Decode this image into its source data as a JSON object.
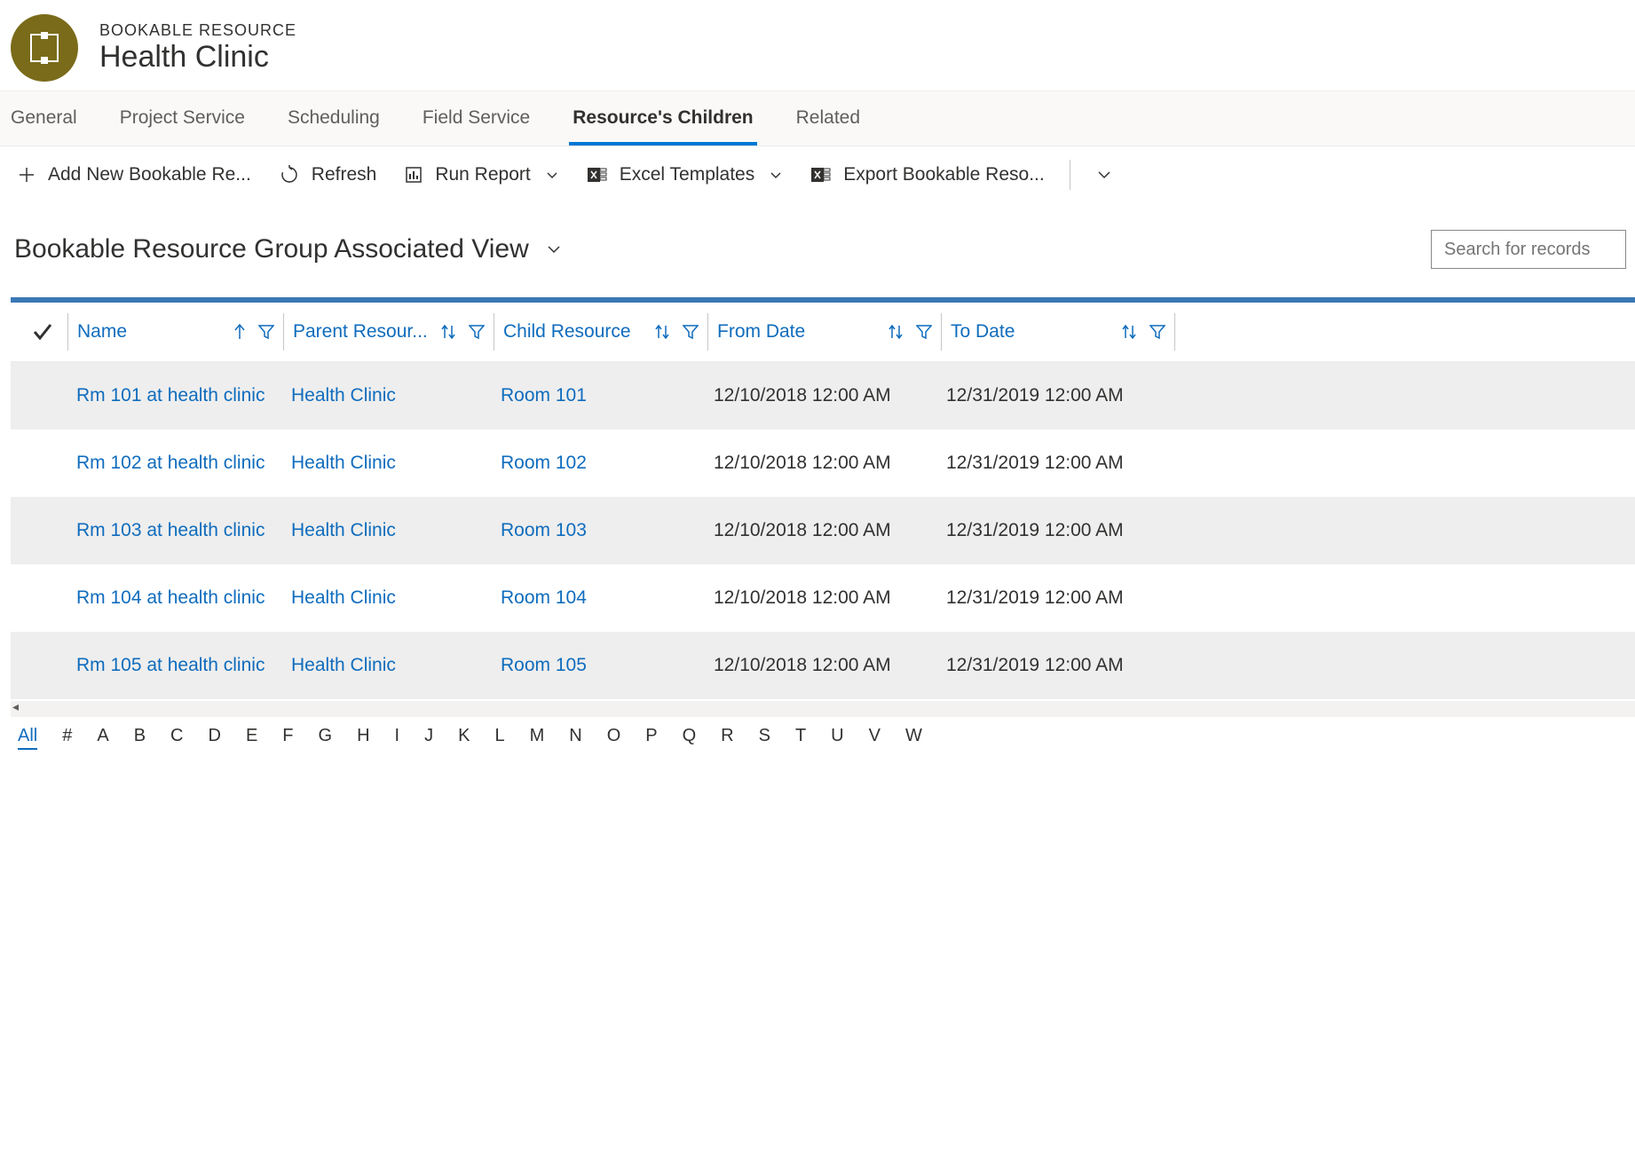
{
  "header": {
    "entity_type": "BOOKABLE RESOURCE",
    "title": "Health Clinic"
  },
  "tabs": [
    {
      "label": "General",
      "active": false
    },
    {
      "label": "Project Service",
      "active": false
    },
    {
      "label": "Scheduling",
      "active": false
    },
    {
      "label": "Field Service",
      "active": false
    },
    {
      "label": "Resource's Children",
      "active": true
    },
    {
      "label": "Related",
      "active": false
    }
  ],
  "toolbar": {
    "add_new": "Add New Bookable Re...",
    "refresh": "Refresh",
    "run_report": "Run Report",
    "excel_templates": "Excel Templates",
    "export": "Export Bookable Reso..."
  },
  "view": {
    "title": "Bookable Resource Group Associated View",
    "search_placeholder": "Search for records"
  },
  "columns": {
    "name": "Name",
    "parent": "Parent Resour...",
    "child": "Child Resource",
    "from": "From Date",
    "to": "To Date"
  },
  "rows": [
    {
      "name": "Rm 101 at health clinic",
      "parent": "Health Clinic",
      "child": "Room 101",
      "from": "12/10/2018 12:00 AM",
      "to": "12/31/2019 12:00 AM"
    },
    {
      "name": "Rm 102 at health clinic",
      "parent": "Health Clinic",
      "child": "Room 102",
      "from": "12/10/2018 12:00 AM",
      "to": "12/31/2019 12:00 AM"
    },
    {
      "name": "Rm 103 at health clinic",
      "parent": "Health Clinic",
      "child": "Room 103",
      "from": "12/10/2018 12:00 AM",
      "to": "12/31/2019 12:00 AM"
    },
    {
      "name": "Rm 104 at health clinic",
      "parent": "Health Clinic",
      "child": "Room 104",
      "from": "12/10/2018 12:00 AM",
      "to": "12/31/2019 12:00 AM"
    },
    {
      "name": "Rm 105 at health clinic",
      "parent": "Health Clinic",
      "child": "Room 105",
      "from": "12/10/2018 12:00 AM",
      "to": "12/31/2019 12:00 AM"
    }
  ],
  "alpha": {
    "items": [
      "All",
      "#",
      "A",
      "B",
      "C",
      "D",
      "E",
      "F",
      "G",
      "H",
      "I",
      "J",
      "K",
      "L",
      "M",
      "N",
      "O",
      "P",
      "Q",
      "R",
      "S",
      "T",
      "U",
      "V",
      "W"
    ],
    "active": "All"
  }
}
